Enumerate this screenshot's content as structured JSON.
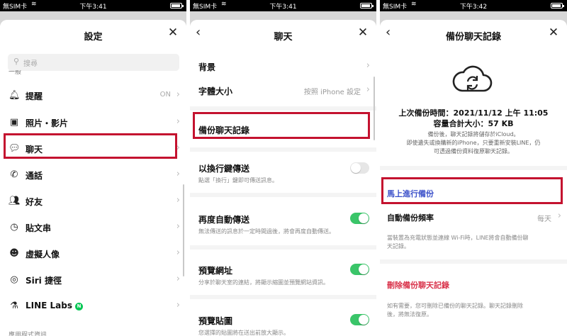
{
  "status_bars": [
    {
      "carrier": "無SIM卡",
      "time": "下午3:41"
    },
    {
      "carrier": "無SIM卡",
      "time": "下午3:41"
    },
    {
      "carrier": "無SIM卡",
      "time": "下午3:42"
    }
  ],
  "settings": {
    "title": "設定",
    "search_placeholder": "搜尋",
    "section_label": "一般",
    "items": [
      {
        "label": "提醒",
        "value": "ON",
        "icon": "bell-icon"
      },
      {
        "label": "照片・影片",
        "value": "",
        "icon": "photo-icon"
      },
      {
        "label": "聊天",
        "value": "",
        "icon": "chat-icon"
      },
      {
        "label": "通話",
        "value": "",
        "icon": "phone-icon"
      },
      {
        "label": "好友",
        "value": "",
        "icon": "friends-icon"
      },
      {
        "label": "貼文串",
        "value": "",
        "icon": "clock-icon"
      },
      {
        "label": "虛擬人像",
        "value": "",
        "icon": "avatar-icon"
      },
      {
        "label": "Siri 捷徑",
        "value": "",
        "icon": "siri-icon"
      },
      {
        "label": "LINE Labs",
        "value": "",
        "icon": "flask-icon",
        "badge": "N"
      }
    ],
    "bottom_label": "應用程式資訊"
  },
  "chat": {
    "title": "聊天",
    "background_label": "背景",
    "font_size_label": "字體大小",
    "font_size_value": "按照 iPhone 設定",
    "backup_label": "備份聊天記錄",
    "enter_send_label": "以換行鍵傳送",
    "enter_send_desc": "點選「換行」鍵即可傳送訊息。",
    "enter_send_on": false,
    "auto_resend_label": "再度自動傳送",
    "auto_resend_desc": "無法傳送的訊息於一定時間過後，將會再度自動傳送。",
    "auto_resend_on": true,
    "preview_url_label": "預覽網址",
    "preview_url_desc": "分享於聊天室的連結，將顯示縮圖並預覽網站資訊。",
    "preview_url_on": true,
    "preview_sticker_label": "預覽貼圖",
    "preview_sticker_desc": "您選擇的貼圖將在送出前放大顯示。",
    "preview_sticker_on": true
  },
  "backup": {
    "title": "備份聊天記錄",
    "last_backup": "上次備份時間：2021/11/12 上午 11:05",
    "total_size": "容量合計大小：57 KB",
    "info_1": "備份後，聊天記錄將儲存於iCloud。",
    "info_2": "即使遺失或換購新的iPhone，只要重新安裝LINE，仍",
    "info_3": "可透過備份資料復原聊天記錄。",
    "backup_now": "馬上進行備份",
    "frequency_label": "自動備份頻率",
    "frequency_value": "每天",
    "frequency_note_1": "當裝置為充電狀態並連線 Wi-Fi時，LINE將會自動備份聊",
    "frequency_note_2": "天記錄。",
    "delete_label": "刪除備份聊天記錄",
    "delete_note_1": "如有需要，您可刪除已備份的聊天記錄。聊天記錄刪除",
    "delete_note_2": "後，將無法復原。"
  },
  "colors": {
    "highlight": "#c4122f",
    "line_green": "#3ac569",
    "link_blue": "#3a4fc9",
    "danger_red": "#d9324a"
  }
}
